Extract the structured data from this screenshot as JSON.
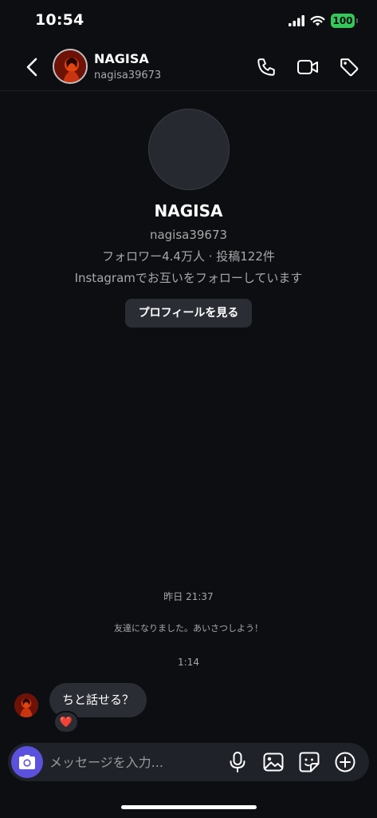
{
  "status_bar": {
    "time": "10:54",
    "battery": "100",
    "icons": [
      "signal-icon",
      "wifi-icon",
      "battery-icon"
    ],
    "battery_color": "#34c759"
  },
  "header": {
    "name": "NAGISA",
    "handle": "nagisa39673",
    "icons": [
      "back-chevron-icon",
      "phone-icon",
      "video-camera-icon",
      "tag-icon"
    ]
  },
  "profile": {
    "name": "NAGISA",
    "handle": "nagisa39673",
    "stats": "フォロワー4.4万人 · 投稿122件",
    "mutual": "Instagramでお互いをフォローしています",
    "view_profile_label": "プロフィールを見る"
  },
  "thread": {
    "timestamp_1": "昨日 21:37",
    "system_message": "友達になりました。あいさつしよう！",
    "timestamp_2": "1:14",
    "messages": [
      {
        "sender": "NAGISA",
        "text": "ちと話せる？",
        "reaction": "❤️"
      }
    ]
  },
  "composer": {
    "placeholder": "メッセージを入力...",
    "icons": [
      "camera-icon",
      "microphone-icon",
      "gallery-icon",
      "sticker-icon",
      "add-icon"
    ],
    "camera_color": "#5b51de"
  },
  "colors": {
    "background": "#0c0e12",
    "bubble": "#2a2d33",
    "secondary_text": "#a8a8a8"
  }
}
